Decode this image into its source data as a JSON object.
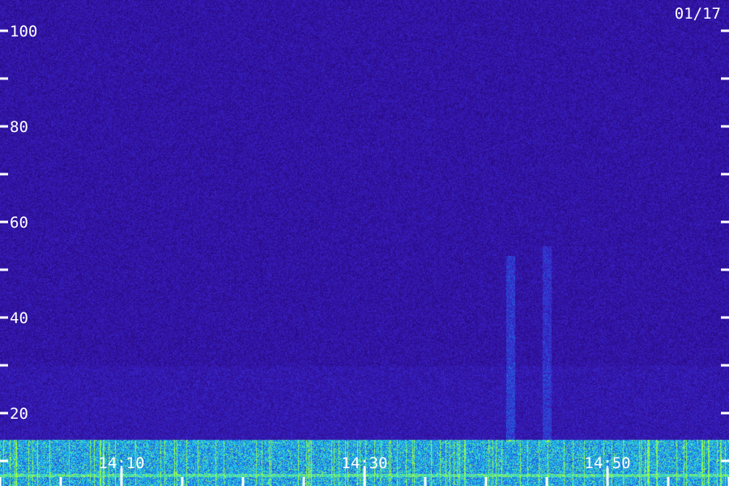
{
  "date_label": "01/17",
  "chart_data": {
    "type": "heatmap",
    "title": "",
    "xlabel": "",
    "ylabel": "",
    "x_ticks": [
      "14:10",
      "14:30",
      "14:50"
    ],
    "y_ticks": [
      20,
      40,
      60,
      80,
      100
    ],
    "ylim": [
      0,
      105
    ],
    "colormap": [
      "#12002e",
      "#2a0a86",
      "#3a22c8",
      "#1b6fe0",
      "#20d0f0",
      "#a8ff30"
    ],
    "features": [
      {
        "kind": "band",
        "y_from": 0,
        "y_to": 14,
        "intensity": 0.75,
        "description_label": ""
      },
      {
        "kind": "line",
        "y": 7,
        "intensity": 0.95
      },
      {
        "kind": "line",
        "y": 14,
        "intensity": 0.7
      },
      {
        "kind": "burst",
        "time": "14:42",
        "y_from": 14,
        "y_to": 53,
        "intensity": 0.5
      },
      {
        "kind": "burst",
        "time": "14:45",
        "y_from": 14,
        "y_to": 55,
        "intensity": 0.42
      }
    ]
  },
  "colors": {
    "background_low": "#12002e",
    "background_mid": "#2a0a86",
    "tick": "#ffffff",
    "label": "#ffffff"
  }
}
